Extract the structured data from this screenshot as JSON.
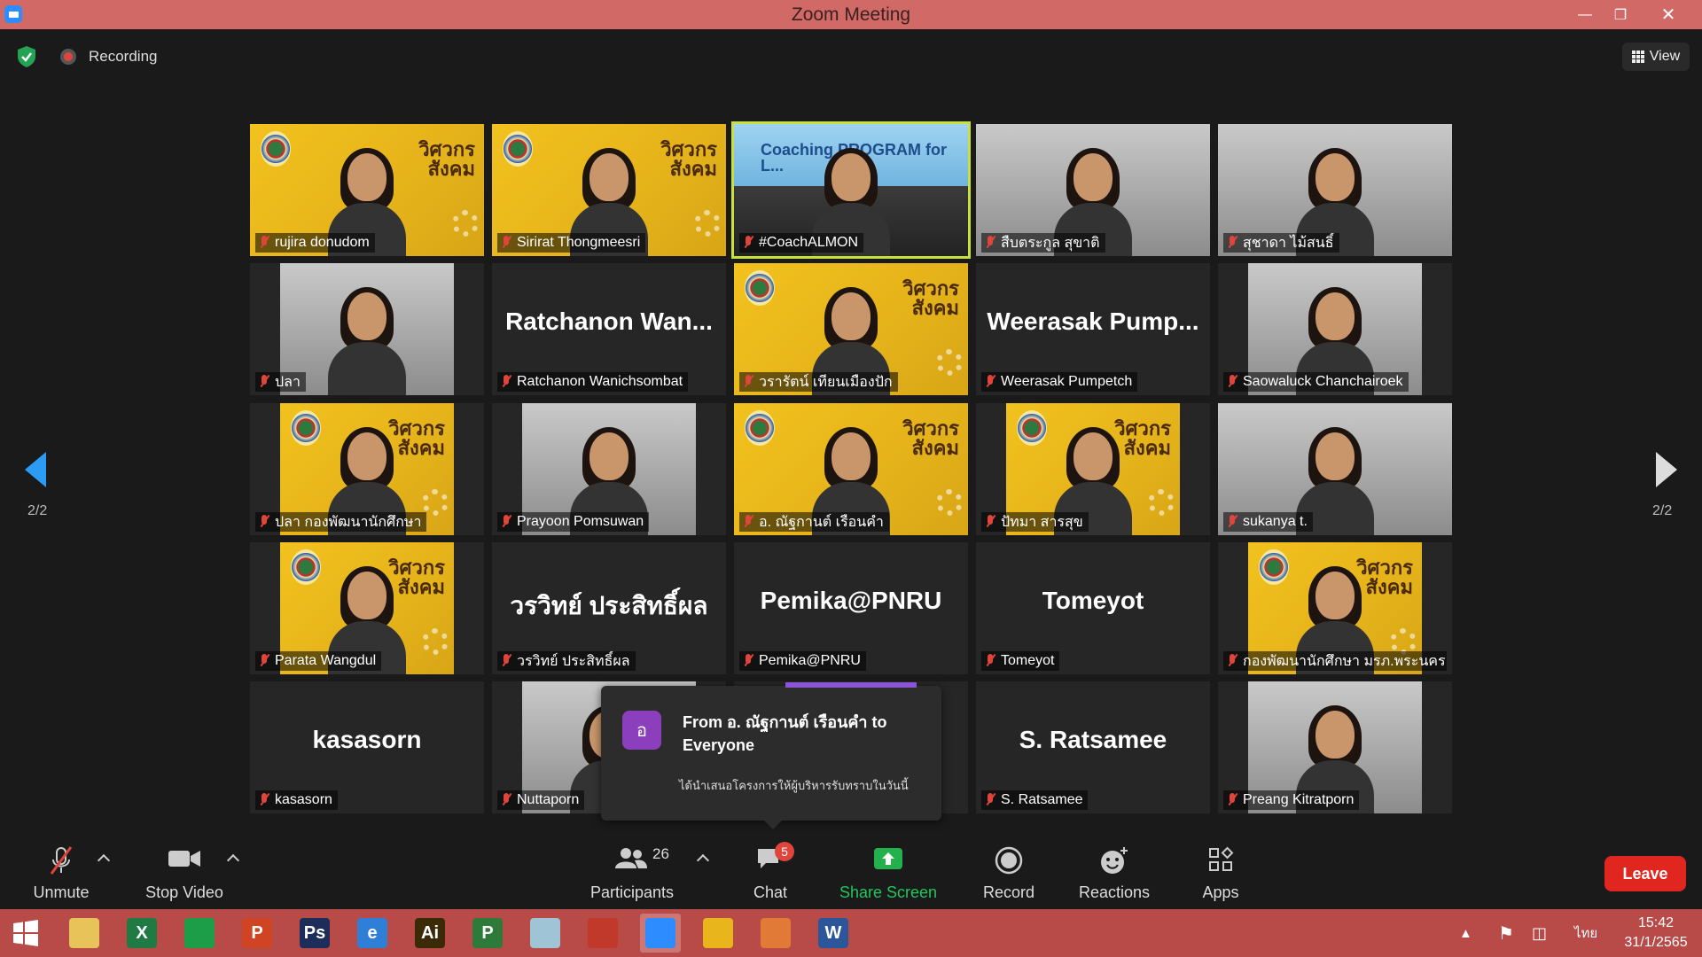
{
  "window": {
    "title": "Zoom Meeting"
  },
  "topbar": {
    "recording_label": "Recording",
    "view_label": "View"
  },
  "pager": {
    "left_page": "2/2",
    "right_page": "2/2"
  },
  "tiles": [
    {
      "name": "rujira donudom",
      "bg": "yellow"
    },
    {
      "name": "Sirirat Thongmeesri",
      "bg": "yellow"
    },
    {
      "name": "#CoachALMON",
      "bg": "coach",
      "active": true,
      "banner": "Coaching PROGRAM for L..."
    },
    {
      "name": "สืบตระกูล สุขาติ",
      "bg": "photo"
    },
    {
      "name": "สุชาดา ไม้สนธิ์",
      "bg": "photo"
    },
    {
      "name": "ปลา",
      "bg": "photo-narrow"
    },
    {
      "name": "Ratchanon Wanichsombat",
      "bg": "dark",
      "big": "Ratchanon  Wan..."
    },
    {
      "name": "วรารัตน์ เทียนเมืองปัก",
      "bg": "yellow"
    },
    {
      "name": "Weerasak Pumpetch",
      "bg": "dark",
      "big": "Weerasak  Pump..."
    },
    {
      "name": "Saowaluck Chanchairoek",
      "bg": "photo-narrow"
    },
    {
      "name": "ปลา กองพัฒนานักศึกษา",
      "bg": "yellow-narrow"
    },
    {
      "name": "Prayoon Pomsuwan",
      "bg": "photo-narrow"
    },
    {
      "name": "อ. ณัฐกานต์  เรือนคำ",
      "bg": "yellow"
    },
    {
      "name": "ปัทมา สารสุข",
      "bg": "yellow-narrow"
    },
    {
      "name": "sukanya t.",
      "bg": "photo"
    },
    {
      "name": "Parata Wangdul",
      "bg": "yellow-narrow"
    },
    {
      "name": "วรวิทย์ ประสิทธิ์ผล",
      "bg": "dark",
      "big": "วรวิทย์ ประสิทธิ์ผล"
    },
    {
      "name": "Pemika@PNRU",
      "bg": "dark",
      "big": "Pemika@PNRU"
    },
    {
      "name": "Tomeyot",
      "bg": "dark",
      "big": "Tomeyot"
    },
    {
      "name": "กองพัฒนานักศึกษา มรภ.พระนคร",
      "bg": "yellow-narrow"
    },
    {
      "name": "kasasorn",
      "bg": "dark",
      "big": "kasasorn"
    },
    {
      "name": "Nuttaporn",
      "bg": "photo-narrow"
    },
    {
      "name": "",
      "bg": "dark"
    },
    {
      "name": "S. Ratsamee",
      "bg": "dark",
      "big": "S. Ratsamee"
    },
    {
      "name": "Preang Kitratporn",
      "bg": "photo-narrow"
    }
  ],
  "slogan": "วิศวกร สังคม",
  "chat_toast": {
    "avatar_letter": "อ",
    "from": "From อ. ณัฐกานต์  เรือนคำ to Everyone",
    "message": "ได้นำเสนอโครงการให้ผู้บริหารรับทราบในวันนี้"
  },
  "toolbar": {
    "unmute": "Unmute",
    "stop_video": "Stop Video",
    "participants": "Participants",
    "participants_count": "26",
    "chat": "Chat",
    "chat_badge": "5",
    "share_screen": "Share Screen",
    "record": "Record",
    "reactions": "Reactions",
    "apps": "Apps",
    "leave": "Leave"
  },
  "taskbar": {
    "apps": [
      {
        "name": "explorer",
        "glyph": "",
        "color": "#e8c35a"
      },
      {
        "name": "excel",
        "glyph": "X",
        "color": "#1f7a44"
      },
      {
        "name": "store",
        "glyph": "",
        "color": "#1b9e47"
      },
      {
        "name": "powerpoint",
        "glyph": "P",
        "color": "#d04423"
      },
      {
        "name": "photoshop",
        "glyph": "Ps",
        "color": "#1b2d58"
      },
      {
        "name": "ie",
        "glyph": "e",
        "color": "#2f7fd6"
      },
      {
        "name": "illustrator",
        "glyph": "Ai",
        "color": "#3a2a08"
      },
      {
        "name": "project",
        "glyph": "P",
        "color": "#2d7a3a"
      },
      {
        "name": "notes",
        "glyph": "",
        "color": "#9fc4d6"
      },
      {
        "name": "photoscape",
        "glyph": "",
        "color": "#c0392b"
      },
      {
        "name": "zoom",
        "glyph": "",
        "color": "#2d8cff",
        "active": true
      },
      {
        "name": "chrome",
        "glyph": "",
        "color": "#e9b51c"
      },
      {
        "name": "photos",
        "glyph": "",
        "color": "#e07a36"
      },
      {
        "name": "word",
        "glyph": "W",
        "color": "#2b579a"
      }
    ],
    "lang": "ไทย",
    "time": "15:42",
    "date": "31/1/2565"
  }
}
